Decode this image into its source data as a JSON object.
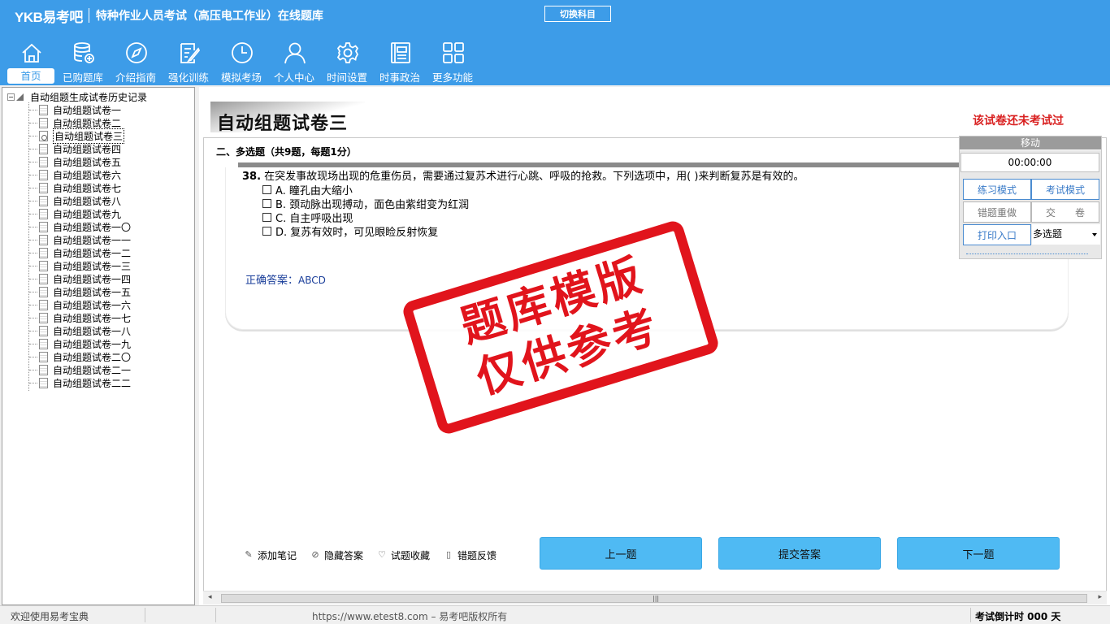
{
  "header": {
    "logo": "YKB易考吧",
    "title": "特种作业人员考试（高压电工作业）在线题库",
    "switch_subject": "切换科目"
  },
  "nav": [
    {
      "label": "首页",
      "icon": "home-icon"
    },
    {
      "label": "已购题库",
      "icon": "database-icon"
    },
    {
      "label": "介绍指南",
      "icon": "compass-icon"
    },
    {
      "label": "强化训练",
      "icon": "edit-icon"
    },
    {
      "label": "模拟考场",
      "icon": "clock-icon"
    },
    {
      "label": "个人中心",
      "icon": "user-icon"
    },
    {
      "label": "时间设置",
      "icon": "gear-icon"
    },
    {
      "label": "时事政治",
      "icon": "news-icon"
    },
    {
      "label": "更多功能",
      "icon": "grid-icon"
    }
  ],
  "tree": {
    "root": "自动组题生成试卷历史记录",
    "items": [
      "自动组题试卷一",
      "自动组题试卷二",
      "自动组题试卷三",
      "自动组题试卷四",
      "自动组题试卷五",
      "自动组题试卷六",
      "自动组题试卷七",
      "自动组题试卷八",
      "自动组题试卷九",
      "自动组题试卷一〇",
      "自动组题试卷一一",
      "自动组题试卷一二",
      "自动组题试卷一三",
      "自动组题试卷一四",
      "自动组题试卷一五",
      "自动组题试卷一六",
      "自动组题试卷一七",
      "自动组题试卷一八",
      "自动组题试卷一九",
      "自动组题试卷二〇",
      "自动组题试卷二一",
      "自动组题试卷二二"
    ],
    "selected_index": 2
  },
  "paper": {
    "title": "自动组题试卷三",
    "status": "该试卷还未考试过",
    "section": "二、多选题（共9题，每题1分）"
  },
  "question": {
    "number": "38.",
    "stem": "在突发事故现场出现的危重伤员，需要通过复苏术进行心跳、呼吸的抢救。下列选项中，用( )来判断复苏是有效的。",
    "options": [
      "A. 瞳孔由大缩小",
      "B. 颈动脉出现搏动，面色由紫绀变为红润",
      "C. 自主呼吸出现",
      "D. 复苏有效时，可见眼睑反射恢复"
    ],
    "answer_label": "正确答案：",
    "answer_value": "ABCD"
  },
  "tools": [
    {
      "label": "添加笔记",
      "icon": "pencil-icon"
    },
    {
      "label": "隐藏答案",
      "icon": "eye-hidden-icon"
    },
    {
      "label": "试题收藏",
      "icon": "heart-icon"
    },
    {
      "label": "错题反馈",
      "icon": "feedback-icon"
    }
  ],
  "buttons": {
    "prev": "上一题",
    "submit": "提交答案",
    "next": "下一题"
  },
  "panel": {
    "move": "移动",
    "timer": "00:00:00",
    "practice_mode": "练习模式",
    "exam_mode": "考试模式",
    "redo_wrong": "错题重做",
    "hand_in": "交　　卷",
    "print": "打印入口",
    "question_type": "多选题"
  },
  "watermark": {
    "line1": "题库模版",
    "line2": "仅供参考"
  },
  "statusbar": {
    "welcome": "欢迎使用易考宝典",
    "site": "https://www.etest8.com – 易考吧版权所有",
    "countdown": "考试倒计时 000 天"
  },
  "colors": {
    "header": "#3d9ce8",
    "button": "#4fbaf3",
    "stamp": "#e1141c",
    "status_red": "#d92020"
  }
}
